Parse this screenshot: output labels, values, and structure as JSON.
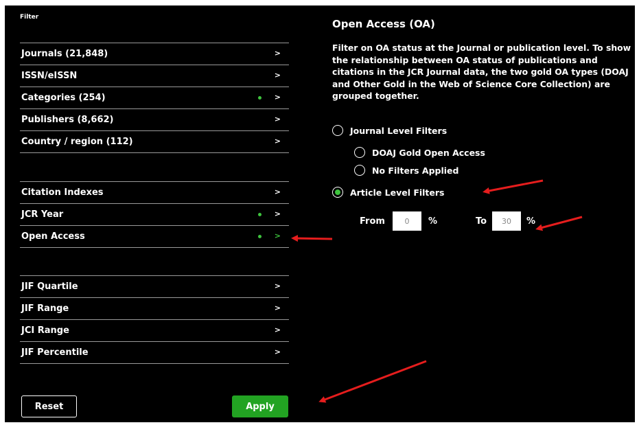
{
  "filter_title": "Filter",
  "groups": [
    {
      "items": [
        {
          "label": "Journals (21,848)",
          "dot": false
        },
        {
          "label": "ISSN/eISSN",
          "dot": false
        },
        {
          "label": "Categories (254)",
          "dot": true
        },
        {
          "label": "Publishers (8,662)",
          "dot": false
        },
        {
          "label": "Country / region (112)",
          "dot": false
        }
      ]
    },
    {
      "items": [
        {
          "label": "Citation Indexes",
          "dot": false
        },
        {
          "label": "JCR Year",
          "dot": true
        },
        {
          "label": "Open Access",
          "dot": true,
          "active": true
        }
      ]
    },
    {
      "items": [
        {
          "label": "JIF Quartile",
          "dot": false
        },
        {
          "label": "JIF Range",
          "dot": false
        },
        {
          "label": "JCI Range",
          "dot": false
        },
        {
          "label": "JIF Percentile",
          "dot": false
        }
      ]
    }
  ],
  "chevron": ">",
  "buttons": {
    "reset": "Reset",
    "apply": "Apply"
  },
  "panel": {
    "title": "Open Access (OA)",
    "description": "Filter on OA status at the Journal or publication level. To show the relationship between OA status of publications and citations in the JCR Journal data, the two gold OA types (DOAJ and Other Gold in the Web of Science Core Collection) are grouped together.",
    "journal_level": "Journal Level Filters",
    "doaj": "DOAJ Gold Open Access",
    "no_filters": "No Filters Applied",
    "article_level": "Article Level Filters",
    "selected": "article_level",
    "range": {
      "from_label": "From",
      "from_value": "0",
      "to_label": "To",
      "to_value": "30",
      "unit": "%"
    }
  },
  "colors": {
    "accent": "#22a322",
    "dot": "#3ec43e",
    "arrow": "#e51d1d",
    "background": "#000000"
  }
}
